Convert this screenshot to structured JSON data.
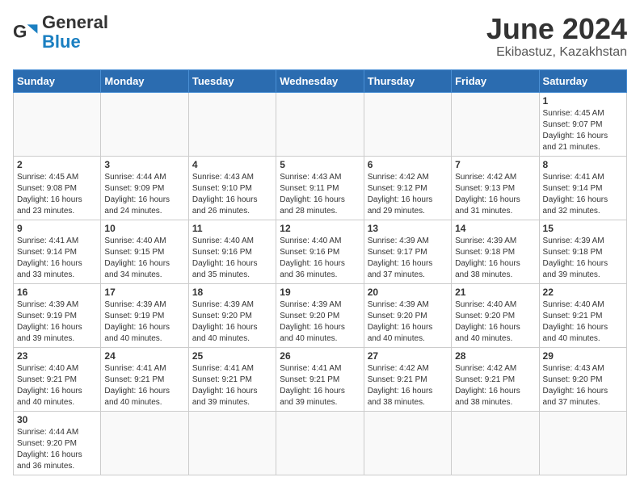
{
  "header": {
    "logo_general": "General",
    "logo_blue": "Blue",
    "title": "June 2024",
    "subtitle": "Ekibastuz, Kazakhstan"
  },
  "weekdays": [
    "Sunday",
    "Monday",
    "Tuesday",
    "Wednesday",
    "Thursday",
    "Friday",
    "Saturday"
  ],
  "weeks": [
    [
      {
        "day": "",
        "info": ""
      },
      {
        "day": "",
        "info": ""
      },
      {
        "day": "",
        "info": ""
      },
      {
        "day": "",
        "info": ""
      },
      {
        "day": "",
        "info": ""
      },
      {
        "day": "",
        "info": ""
      },
      {
        "day": "1",
        "info": "Sunrise: 4:45 AM\nSunset: 9:07 PM\nDaylight: 16 hours\nand 21 minutes."
      }
    ],
    [
      {
        "day": "2",
        "info": "Sunrise: 4:45 AM\nSunset: 9:08 PM\nDaylight: 16 hours\nand 23 minutes."
      },
      {
        "day": "3",
        "info": "Sunrise: 4:44 AM\nSunset: 9:09 PM\nDaylight: 16 hours\nand 24 minutes."
      },
      {
        "day": "4",
        "info": "Sunrise: 4:43 AM\nSunset: 9:10 PM\nDaylight: 16 hours\nand 26 minutes."
      },
      {
        "day": "5",
        "info": "Sunrise: 4:43 AM\nSunset: 9:11 PM\nDaylight: 16 hours\nand 28 minutes."
      },
      {
        "day": "6",
        "info": "Sunrise: 4:42 AM\nSunset: 9:12 PM\nDaylight: 16 hours\nand 29 minutes."
      },
      {
        "day": "7",
        "info": "Sunrise: 4:42 AM\nSunset: 9:13 PM\nDaylight: 16 hours\nand 31 minutes."
      },
      {
        "day": "8",
        "info": "Sunrise: 4:41 AM\nSunset: 9:14 PM\nDaylight: 16 hours\nand 32 minutes."
      }
    ],
    [
      {
        "day": "9",
        "info": "Sunrise: 4:41 AM\nSunset: 9:14 PM\nDaylight: 16 hours\nand 33 minutes."
      },
      {
        "day": "10",
        "info": "Sunrise: 4:40 AM\nSunset: 9:15 PM\nDaylight: 16 hours\nand 34 minutes."
      },
      {
        "day": "11",
        "info": "Sunrise: 4:40 AM\nSunset: 9:16 PM\nDaylight: 16 hours\nand 35 minutes."
      },
      {
        "day": "12",
        "info": "Sunrise: 4:40 AM\nSunset: 9:16 PM\nDaylight: 16 hours\nand 36 minutes."
      },
      {
        "day": "13",
        "info": "Sunrise: 4:39 AM\nSunset: 9:17 PM\nDaylight: 16 hours\nand 37 minutes."
      },
      {
        "day": "14",
        "info": "Sunrise: 4:39 AM\nSunset: 9:18 PM\nDaylight: 16 hours\nand 38 minutes."
      },
      {
        "day": "15",
        "info": "Sunrise: 4:39 AM\nSunset: 9:18 PM\nDaylight: 16 hours\nand 39 minutes."
      }
    ],
    [
      {
        "day": "16",
        "info": "Sunrise: 4:39 AM\nSunset: 9:19 PM\nDaylight: 16 hours\nand 39 minutes."
      },
      {
        "day": "17",
        "info": "Sunrise: 4:39 AM\nSunset: 9:19 PM\nDaylight: 16 hours\nand 40 minutes."
      },
      {
        "day": "18",
        "info": "Sunrise: 4:39 AM\nSunset: 9:20 PM\nDaylight: 16 hours\nand 40 minutes."
      },
      {
        "day": "19",
        "info": "Sunrise: 4:39 AM\nSunset: 9:20 PM\nDaylight: 16 hours\nand 40 minutes."
      },
      {
        "day": "20",
        "info": "Sunrise: 4:39 AM\nSunset: 9:20 PM\nDaylight: 16 hours\nand 40 minutes."
      },
      {
        "day": "21",
        "info": "Sunrise: 4:40 AM\nSunset: 9:20 PM\nDaylight: 16 hours\nand 40 minutes."
      },
      {
        "day": "22",
        "info": "Sunrise: 4:40 AM\nSunset: 9:21 PM\nDaylight: 16 hours\nand 40 minutes."
      }
    ],
    [
      {
        "day": "23",
        "info": "Sunrise: 4:40 AM\nSunset: 9:21 PM\nDaylight: 16 hours\nand 40 minutes."
      },
      {
        "day": "24",
        "info": "Sunrise: 4:41 AM\nSunset: 9:21 PM\nDaylight: 16 hours\nand 40 minutes."
      },
      {
        "day": "25",
        "info": "Sunrise: 4:41 AM\nSunset: 9:21 PM\nDaylight: 16 hours\nand 39 minutes."
      },
      {
        "day": "26",
        "info": "Sunrise: 4:41 AM\nSunset: 9:21 PM\nDaylight: 16 hours\nand 39 minutes."
      },
      {
        "day": "27",
        "info": "Sunrise: 4:42 AM\nSunset: 9:21 PM\nDaylight: 16 hours\nand 38 minutes."
      },
      {
        "day": "28",
        "info": "Sunrise: 4:42 AM\nSunset: 9:21 PM\nDaylight: 16 hours\nand 38 minutes."
      },
      {
        "day": "29",
        "info": "Sunrise: 4:43 AM\nSunset: 9:20 PM\nDaylight: 16 hours\nand 37 minutes."
      }
    ],
    [
      {
        "day": "30",
        "info": "Sunrise: 4:44 AM\nSunset: 9:20 PM\nDaylight: 16 hours\nand 36 minutes."
      },
      {
        "day": "",
        "info": ""
      },
      {
        "day": "",
        "info": ""
      },
      {
        "day": "",
        "info": ""
      },
      {
        "day": "",
        "info": ""
      },
      {
        "day": "",
        "info": ""
      },
      {
        "day": "",
        "info": ""
      }
    ]
  ]
}
